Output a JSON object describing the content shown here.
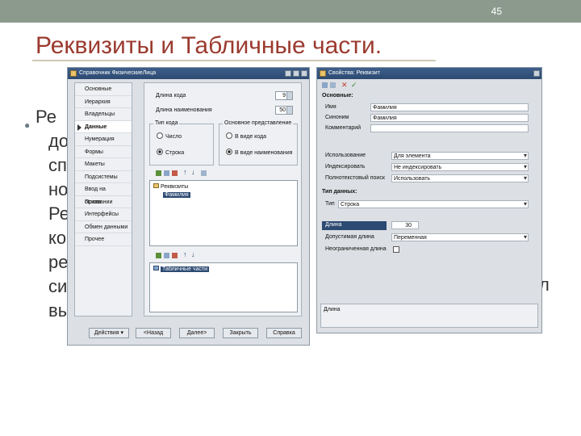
{
  "slide": {
    "page_number": "45",
    "title": "Реквизиты и Табличные части.",
    "bullet_text": "Ре до сп но Ре ко ре си вы",
    "bullet_lines": [
      "Ре",
      "до",
      "сп",
      "но",
      "Ре",
      "ко",
      "ре",
      "си",
      "вы"
    ],
    "bullet_tail": "л"
  },
  "left_window": {
    "title": "Справочник ФизическиеЛица",
    "nav_items": [
      "Основные",
      "Иерархия",
      "Владельцы",
      "Данные",
      "Нумерация",
      "Формы",
      "Макеты",
      "Подсистемы",
      "Ввод на основании",
      "Права",
      "Интерфейсы",
      "Обмен данными",
      "Прочее"
    ],
    "active_nav": "Данные",
    "code_length_label": "Длина кода",
    "code_length_value": "9",
    "name_length_label": "Длина наименования",
    "name_length_value": "50",
    "code_type_group": "Тип кода",
    "code_type_options": [
      "Число",
      "Строка"
    ],
    "main_repr_group": "Основное представление",
    "main_repr_options": [
      "В виде кода",
      "В виде наименования"
    ],
    "attributes_tree_root": "Реквизиты",
    "attributes_tree_item": "Фамилия",
    "tabular_tree_root": "Табличные части",
    "footer_buttons": [
      "Действия ▾",
      "<Назад",
      "Далее>",
      "Закрыть",
      "Справка"
    ]
  },
  "right_window": {
    "title": "Свойства: Реквизит",
    "section_basic": "Основные:",
    "name_label": "Имя",
    "name_value": "Фамилия",
    "synonym_label": "Синоним",
    "synonym_value": "Фамилия",
    "comment_label": "Комментарий",
    "comment_value": "",
    "usage_label": "Использование",
    "usage_value": "Для элемента",
    "indexing_label": "Индексировать",
    "indexing_value": "Не индексировать",
    "fulltext_label": "Полнотекстовый поиск",
    "fulltext_value": "Использовать",
    "section_datatype": "Тип данных:",
    "type_label": "Тип",
    "type_value": "Строка",
    "length_label": "Длина",
    "length_value": "30",
    "allowed_length_label": "Допустимая длина",
    "allowed_length_value": "Переменная",
    "unlimited_length_label": "Неограниченная длина",
    "status_text": "Длина"
  },
  "colors": {
    "title_red": "#9b3a2f",
    "topbar": "#8c9a8e",
    "window_titlebar": "#2c4a72"
  }
}
